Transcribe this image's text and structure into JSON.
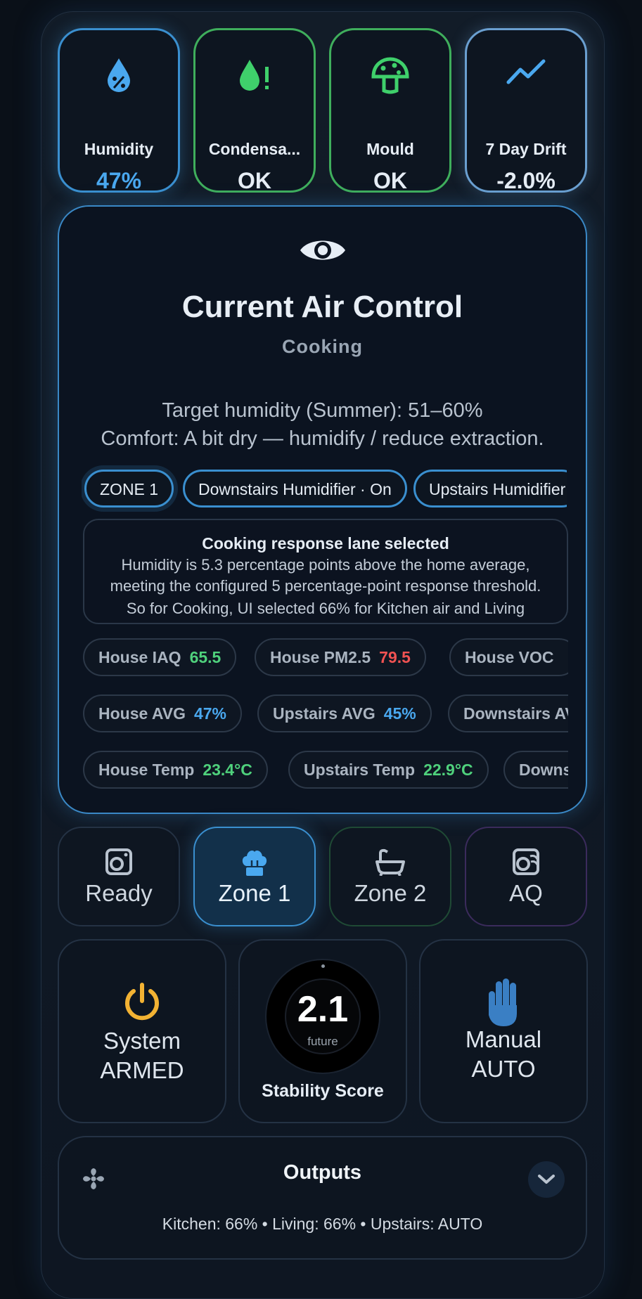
{
  "stats": [
    {
      "label": "Humidity",
      "value": "47%",
      "icon": "humidity-percent-icon",
      "color": "#4aa8ef"
    },
    {
      "label": "Condensa...",
      "value": "OK",
      "icon": "water-alert-icon",
      "color": "#3fae5c"
    },
    {
      "label": "Mould",
      "value": "OK",
      "icon": "mushroom-icon",
      "color": "#3fae5c"
    },
    {
      "label": "7 Day Drift",
      "value": "-2.0%",
      "icon": "trend-line-icon",
      "color": "#6a9fd0"
    }
  ],
  "main": {
    "icon": "eye-icon",
    "title": "Current Air Control",
    "subtitle": "Cooking",
    "target": "Target humidity (Summer): 51–60%",
    "comfort": "Comfort: A bit dry — humidify / reduce extraction.",
    "zones": [
      "ZONE 1",
      "Downstairs Humidifier · On",
      "Upstairs Humidifier"
    ],
    "lane": {
      "title": "Cooking response lane selected",
      "body": "Humidity is 5.3 percentage points above the home average, meeting the configured 5 percentage-point response threshold.",
      "body2": "So for Cooking, UI selected 66% for Kitchen air and Living"
    },
    "pills_row1": [
      {
        "label": "House IAQ",
        "value": "65.5",
        "tone": "green"
      },
      {
        "label": "House PM2.5",
        "value": "79.5",
        "tone": "red"
      },
      {
        "label": "House VOC",
        "value": "",
        "tone": "green"
      }
    ],
    "pills_row2": [
      {
        "label": "House AVG",
        "value": "47%",
        "tone": "blue"
      },
      {
        "label": "Upstairs AVG",
        "value": "45%",
        "tone": "blue"
      },
      {
        "label": "Downstairs AVG",
        "value": "",
        "tone": "blue"
      }
    ],
    "pills_row3": [
      {
        "label": "House Temp",
        "value": "23.4°C",
        "tone": "green"
      },
      {
        "label": "Upstairs Temp",
        "value": "22.9°C",
        "tone": "green"
      },
      {
        "label": "Downstairs Temp",
        "value": "",
        "tone": "green"
      }
    ]
  },
  "modes": [
    {
      "label": "Ready",
      "icon": "washing-machine-icon",
      "active": false
    },
    {
      "label": "Zone 1",
      "icon": "chef-hat-icon",
      "active": true
    },
    {
      "label": "Zone 2",
      "icon": "bathtub-icon",
      "active": false
    },
    {
      "label": "AQ",
      "icon": "air-quality-icon",
      "active": false
    }
  ],
  "system": {
    "line1": "System",
    "line2": "ARMED",
    "icon": "power-icon",
    "color": "#f2b233"
  },
  "stability": {
    "score": "2.1",
    "sub": "future",
    "label": "Stability Score"
  },
  "manual": {
    "line1": "Manual",
    "line2": "AUTO",
    "icon": "hand-icon",
    "color": "#3a7fc4"
  },
  "outputs": {
    "title": "Outputs",
    "summary": "Kitchen: 66% • Living: 66% • Upstairs: AUTO",
    "icon": "fan-icon",
    "toggle_icon": "chevron-down-icon"
  }
}
